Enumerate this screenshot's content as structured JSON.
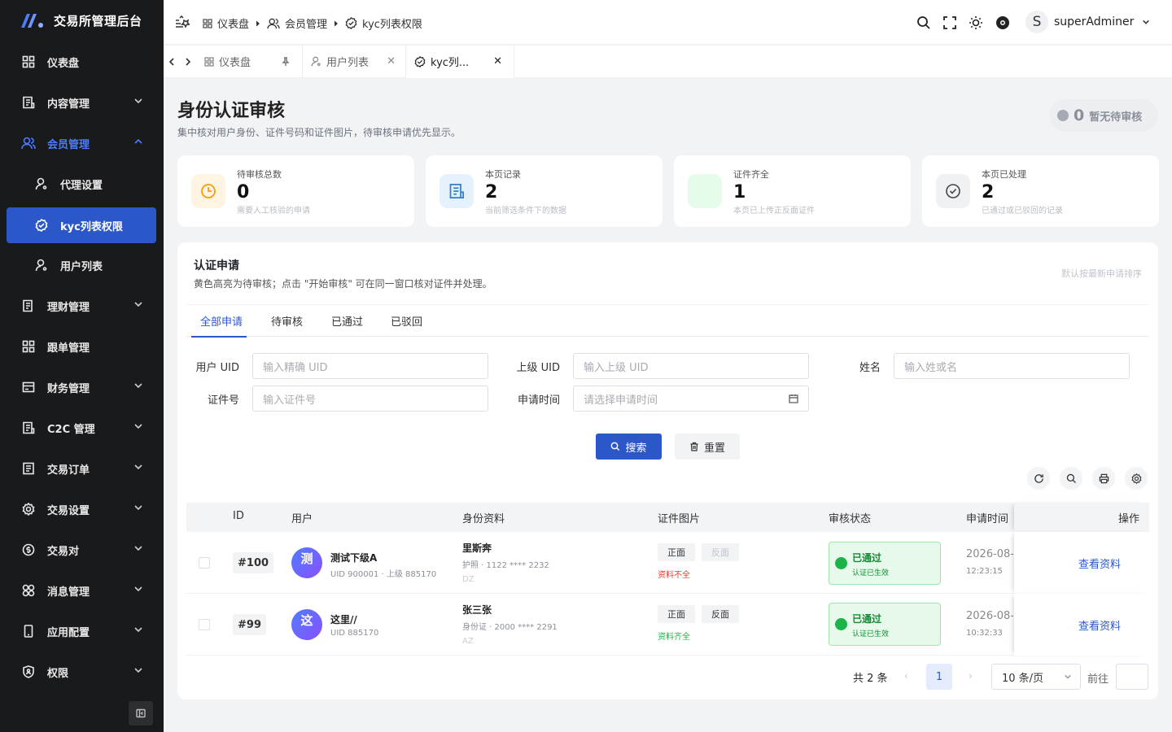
{
  "app": {
    "title": "交易所管理后台"
  },
  "sidebar": {
    "items": [
      {
        "label": "仪表盘",
        "icon": "dashboard-icon"
      },
      {
        "label": "内容管理",
        "icon": "document-icon"
      },
      {
        "label": "会员管理",
        "icon": "users-icon"
      },
      {
        "label": "代理设置",
        "icon": "user-icon"
      },
      {
        "label": "kyc列表权限",
        "icon": "check-circle-icon"
      },
      {
        "label": "用户列表",
        "icon": "user-icon"
      },
      {
        "label": "理财管理",
        "icon": "document-icon"
      },
      {
        "label": "跟单管理",
        "icon": "grid-icon"
      },
      {
        "label": "财务管理",
        "icon": "card-icon"
      },
      {
        "label": "C2C 管理",
        "icon": "document-icon"
      },
      {
        "label": "交易订单",
        "icon": "list-icon"
      },
      {
        "label": "交易设置",
        "icon": "gear-icon"
      },
      {
        "label": "交易对",
        "icon": "coin-icon"
      },
      {
        "label": "消息管理",
        "icon": "apps-icon"
      },
      {
        "label": "应用配置",
        "icon": "phone-icon"
      },
      {
        "label": "权限",
        "icon": "shield-icon"
      }
    ]
  },
  "breadcrumb": [
    "仪表盘",
    "会员管理",
    "kyc列表权限"
  ],
  "header": {
    "user_initial": "S",
    "user_name": "superAdminer"
  },
  "tabs": [
    {
      "label": "仪表盘"
    },
    {
      "label": "用户列表"
    },
    {
      "label": "kyc列..."
    }
  ],
  "page": {
    "title": "身份认证审核",
    "subtitle": "集中核对用户身份、证件号码和证件图片，待审核申请优先显示。",
    "pending_pill": {
      "count": "0",
      "text": "暂无待审核"
    }
  },
  "stats": [
    {
      "label": "待审核总数",
      "value": "0",
      "hint": "需要人工核验的申请"
    },
    {
      "label": "本页记录",
      "value": "2",
      "hint": "当前筛选条件下的数据"
    },
    {
      "label": "证件齐全",
      "value": "1",
      "hint": "本页已上传正反面证件"
    },
    {
      "label": "本页已处理",
      "value": "2",
      "hint": "已通过或已驳回的记录"
    }
  ],
  "panel": {
    "title": "认证申请",
    "desc": "黄色高亮为待审核；点击 \"开始审核\" 可在同一窗口核对证件并处理。",
    "sort_hint": "默认按最新申请排序",
    "tabs": [
      "全部申请",
      "待审核",
      "已通过",
      "已驳回"
    ]
  },
  "filters": {
    "uid_label": "用户 UID",
    "uid_placeholder": "输入精确 UID",
    "parent_label": "上级 UID",
    "parent_placeholder": "输入上级 UID",
    "name_label": "姓名",
    "name_placeholder": "输入姓或名",
    "cert_label": "证件号",
    "cert_placeholder": "输入证件号",
    "time_label": "申请时间",
    "time_placeholder": "请选择申请时间",
    "search_label": "搜索",
    "reset_label": "重置"
  },
  "table": {
    "columns": [
      "ID",
      "用户",
      "身份资料",
      "证件图片",
      "审核状态",
      "申请时间",
      "操作"
    ],
    "rows": [
      {
        "id": "#100",
        "avatar": "测",
        "name": "测试下级A",
        "uid": "UID 900001 · 上级 885170",
        "real_name": "里斯奔",
        "doc": "护照 · 1122 **** 2232",
        "country": "DZ",
        "front": "正面",
        "back": "反面",
        "doc_status": "资料不全",
        "status": "已通过",
        "status_sub": "认证已生效",
        "date": "2026-08-",
        "time": "12:23:15",
        "action": "查看资料"
      },
      {
        "id": "#99",
        "avatar": "这",
        "name": "这里//",
        "uid": "UID 885170",
        "real_name": "张三张",
        "doc": "身份证 · 2000 **** 2291",
        "country": "AZ",
        "front": "正面",
        "back": "反面",
        "doc_status": "资料齐全",
        "status": "已通过",
        "status_sub": "认证已生效",
        "date": "2026-08-",
        "time": "10:32:33",
        "action": "查看资料"
      }
    ]
  },
  "pagination": {
    "total": "共 2 条",
    "current": "1",
    "page_size": "10 条/页",
    "goto": "前往"
  },
  "colors": {
    "primary": "#2b57c9",
    "sidebar_bg": "#191a1c",
    "success": "#1bb34a",
    "danger": "#e53935"
  }
}
